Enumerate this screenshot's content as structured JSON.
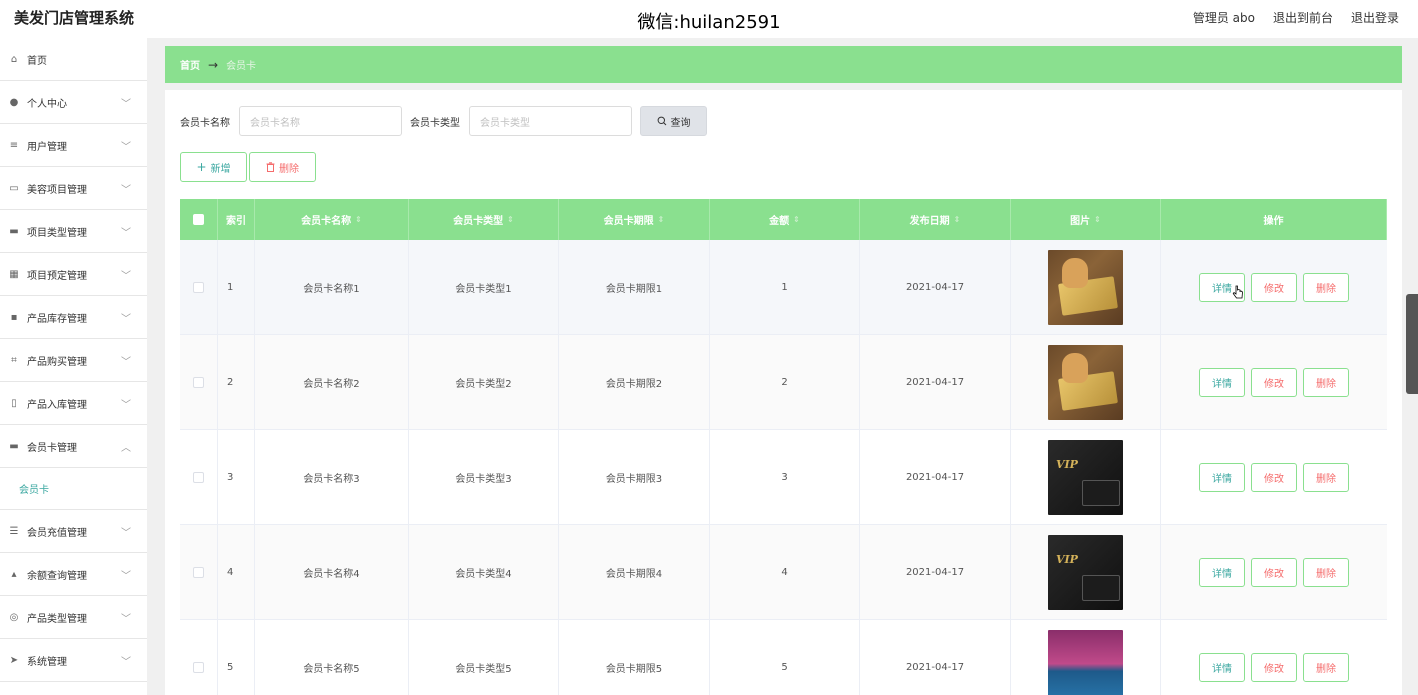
{
  "header": {
    "app_title": "美发门店管理系统",
    "center_text": "微信:huilan2591",
    "admin": "管理员 abo",
    "to_front": "退出到前台",
    "logout": "退出登录"
  },
  "sidebar": {
    "items": [
      {
        "label": "首页",
        "icon": "home-icon",
        "has_arrow": false
      },
      {
        "label": "个人中心",
        "icon": "user-icon",
        "has_arrow": true
      },
      {
        "label": "用户管理",
        "icon": "sliders-icon",
        "has_arrow": true
      },
      {
        "label": "美容项目管理",
        "icon": "chat-icon",
        "has_arrow": true
      },
      {
        "label": "项目类型管理",
        "icon": "monitor-icon",
        "has_arrow": true
      },
      {
        "label": "项目预定管理",
        "icon": "grid-icon",
        "has_arrow": true
      },
      {
        "label": "产品库存管理",
        "icon": "message-icon",
        "has_arrow": true
      },
      {
        "label": "产品购买管理",
        "icon": "scan-icon",
        "has_arrow": true
      },
      {
        "label": "产品入库管理",
        "icon": "mic-icon",
        "has_arrow": true
      },
      {
        "label": "会员卡管理",
        "icon": "card-icon",
        "has_arrow": true,
        "expanded": true
      },
      {
        "label": "会员充值管理",
        "icon": "menu-icon",
        "has_arrow": true
      },
      {
        "label": "余额查询管理",
        "icon": "thumb-icon",
        "has_arrow": true
      },
      {
        "label": "产品类型管理",
        "icon": "compass-icon",
        "has_arrow": true
      },
      {
        "label": "系统管理",
        "icon": "send-icon",
        "has_arrow": true
      }
    ],
    "sub_item": "会员卡"
  },
  "breadcrumb": {
    "home": "首页",
    "current": "会员卡"
  },
  "search": {
    "name_label": "会员卡名称",
    "name_placeholder": "会员卡名称",
    "type_label": "会员卡类型",
    "type_placeholder": "会员卡类型",
    "query_button": "查询"
  },
  "actions": {
    "add": "新增",
    "delete": "删除"
  },
  "table": {
    "headers": [
      "索引",
      "会员卡名称",
      "会员卡类型",
      "会员卡期限",
      "金额",
      "发布日期",
      "图片",
      "操作"
    ],
    "rows": [
      {
        "index": "1",
        "name": "会员卡名称1",
        "type": "会员卡类型1",
        "period": "会员卡期限1",
        "amount": "1",
        "date": "2021-04-17",
        "image": "gold"
      },
      {
        "index": "2",
        "name": "会员卡名称2",
        "type": "会员卡类型2",
        "period": "会员卡期限2",
        "amount": "2",
        "date": "2021-04-17",
        "image": "gold"
      },
      {
        "index": "3",
        "name": "会员卡名称3",
        "type": "会员卡类型3",
        "period": "会员卡期限3",
        "amount": "3",
        "date": "2021-04-17",
        "image": "black"
      },
      {
        "index": "4",
        "name": "会员卡名称4",
        "type": "会员卡类型4",
        "period": "会员卡期限4",
        "amount": "4",
        "date": "2021-04-17",
        "image": "black"
      },
      {
        "index": "5",
        "name": "会员卡名称5",
        "type": "会员卡类型5",
        "period": "会员卡期限5",
        "amount": "5",
        "date": "2021-04-17",
        "image": "pink"
      }
    ],
    "row_actions": {
      "detail": "详情",
      "edit": "修改",
      "remove": "删除"
    }
  },
  "colors": {
    "accent_green": "#8ae08f",
    "teal_text": "#3aa7a0",
    "danger": "#f56c6c"
  }
}
